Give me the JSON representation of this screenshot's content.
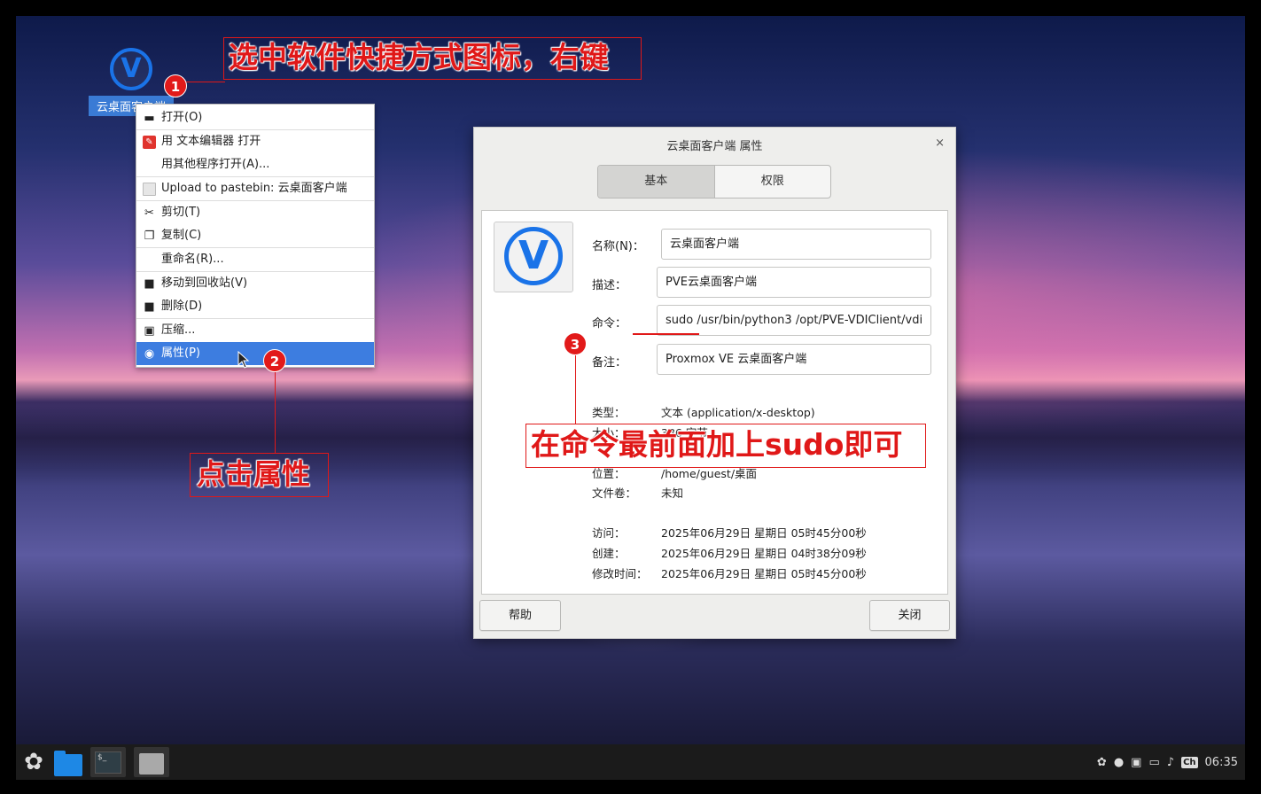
{
  "desktop": {
    "icon_label": "云桌面客户端",
    "icon_glyph": "V"
  },
  "annotations": {
    "step1_badge": "1",
    "step1_text": "选中软件快捷方式图标，右键",
    "step2_badge": "2",
    "step2_text": "点击属性",
    "step3_badge": "3",
    "step3_text": "在命令最前面加上sudo即可",
    "color": "#e01818"
  },
  "context_menu": {
    "items": [
      {
        "icon": "folder-open-icon",
        "label": "打开(O)"
      },
      {
        "icon": "text-editor-icon",
        "label": "用 文本编辑器 打开"
      },
      {
        "icon": "",
        "label": "用其他程序打开(A)..."
      },
      {
        "icon": "document-icon",
        "label": "Upload to pastebin: 云桌面客户端"
      },
      {
        "icon": "scissors-icon",
        "label": "剪切(T)"
      },
      {
        "icon": "copy-icon",
        "label": "复制(C)"
      },
      {
        "icon": "",
        "label": "重命名(R)..."
      },
      {
        "icon": "trash-icon",
        "label": "移动到回收站(V)"
      },
      {
        "icon": "trash-icon",
        "label": "删除(D)"
      },
      {
        "icon": "compress-icon",
        "label": "压缩..."
      },
      {
        "icon": "eye-icon",
        "label": "属性(P)"
      }
    ],
    "selected_color": "#3d7de0"
  },
  "dialog": {
    "title": "云桌面客户端 属性",
    "close_glyph": "×",
    "tabs": [
      "基本",
      "权限"
    ],
    "fields": {
      "name_label": "名称(N)：",
      "name_value": "云桌面客户端",
      "desc_label": "描述：",
      "desc_value": "PVE云桌面客户端",
      "cmd_label": "命令：",
      "cmd_value": "sudo /usr/bin/python3 /opt/PVE-VDIClient/vdi",
      "note_label": "备注：",
      "note_value": "Proxmox VE 云桌面客户端"
    },
    "info": {
      "type_label": "类型：",
      "type_value": "文本 (application/x-desktop)",
      "size_label": "大小：",
      "size_value": "386 字节",
      "loc_label": "位置：",
      "loc_value": "/home/guest/桌面",
      "vol_label": "文件卷：",
      "vol_value": "未知",
      "access_label": "访问：",
      "access_value": "2025年06月29日 星期日 05时45分00秒",
      "created_label": "创建：",
      "created_value": "2025年06月29日 星期日 04时38分09秒",
      "modified_label": "修改时间：",
      "modified_value": "2025年06月29日 星期日 05时45分00秒"
    },
    "help_button": "帮助",
    "close_button": "关闭"
  },
  "taskbar": {
    "terminal_glyph": "$_",
    "input_method": "Ch",
    "clock": "06:35"
  }
}
